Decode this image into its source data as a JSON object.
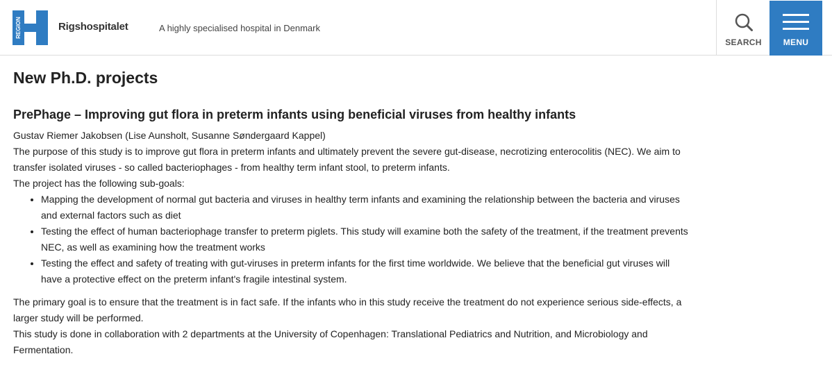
{
  "header": {
    "logo_text": "REGION",
    "site_name": "Rigshospitalet",
    "tagline": "A highly specialised hospital in Denmark",
    "search_label": "SEARCH",
    "menu_label": "MENU",
    "brand_color": "#2f7cc2",
    "search_icon": "search-icon",
    "menu_icon": "hamburger-icon"
  },
  "main": {
    "page_title": "New Ph.D. projects",
    "project_title": "PrePhage – Improving gut flora in preterm infants using beneficial viruses from healthy infants",
    "authors": "Gustav Riemer Jakobsen (Lise Aunsholt, Susanne Søndergaard Kappel)",
    "purpose": "The purpose of this study is to improve gut flora in preterm infants and ultimately prevent the severe gut-disease, necrotizing enterocolitis (NEC). We aim to transfer isolated viruses - so called bacteriophages - from healthy term infant stool, to preterm infants.",
    "subgoals_intro": "The project has the following sub-goals:",
    "subgoals": [
      "Mapping the development of normal gut bacteria and viruses in healthy term infants and examining the relationship between the bacteria and viruses and external factors such as diet",
      "Testing the effect of human bacteriophage transfer to preterm piglets. This study will examine both the safety of the treatment, if the treatment prevents NEC, as well as examining how the treatment works",
      "Testing the effect and safety of treating with gut-viruses in preterm infants for the first time worldwide. We believe that the beneficial gut viruses will have a protective effect on the preterm infant's fragile intestinal system."
    ],
    "primary_goal": "The primary goal is to ensure that the treatment is in fact safe. If the infants who in this study receive the treatment do not experience serious side-effects, a larger study will be performed.",
    "collaboration": "This study is done in collaboration with 2 departments at the University of Copenhagen: Translational Pediatrics and Nutrition, and Microbiology and Fermentation."
  }
}
